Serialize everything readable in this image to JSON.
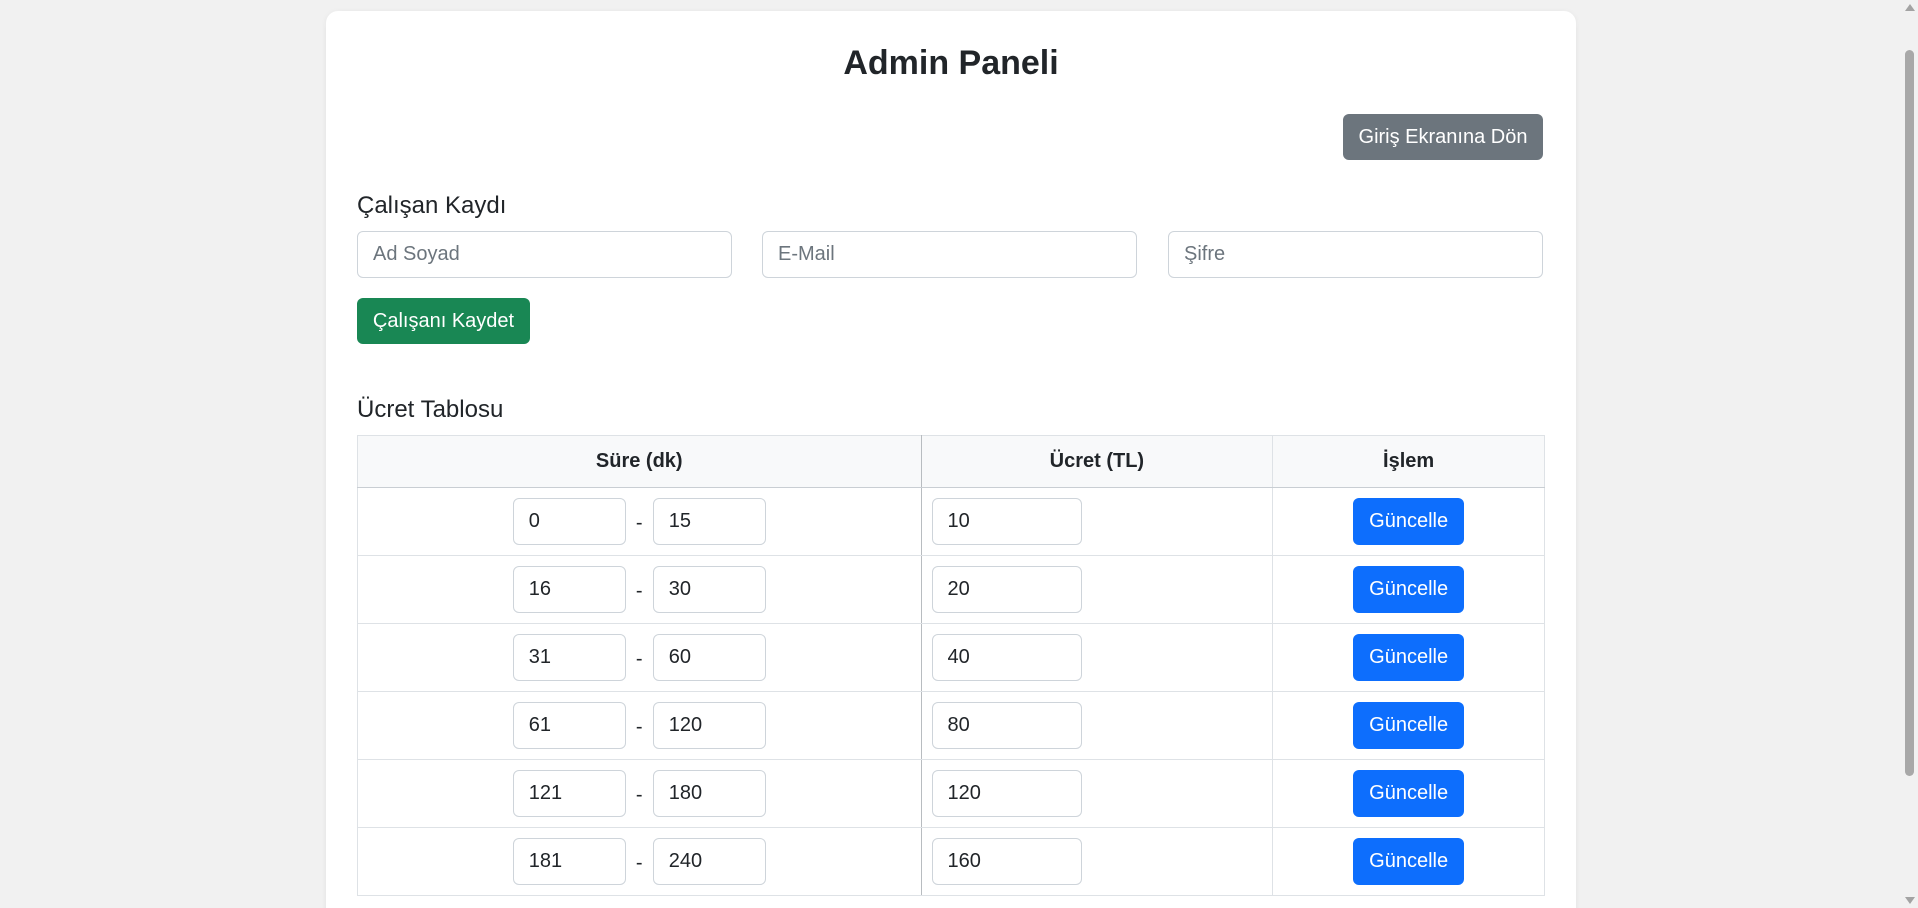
{
  "header": {
    "title": "Admin Paneli",
    "back_button_label": "Giriş Ekranına Dön"
  },
  "employee_form": {
    "heading": "Çalışan Kaydı",
    "name_placeholder": "Ad Soyad",
    "email_placeholder": "E-Mail",
    "password_placeholder": "Şifre",
    "save_button_label": "Çalışanı Kaydet"
  },
  "fee_table": {
    "heading": "Ücret Tablosu",
    "columns": [
      "Süre (dk)",
      "Ücret (TL)",
      "İşlem"
    ],
    "separator": "-",
    "rows": [
      {
        "min": "0",
        "max": "15",
        "fee": "10",
        "action_label": "Güncelle"
      },
      {
        "min": "16",
        "max": "30",
        "fee": "20",
        "action_label": "Güncelle"
      },
      {
        "min": "31",
        "max": "60",
        "fee": "40",
        "action_label": "Güncelle"
      },
      {
        "min": "61",
        "max": "120",
        "fee": "80",
        "action_label": "Güncelle"
      },
      {
        "min": "121",
        "max": "180",
        "fee": "120",
        "action_label": "Güncelle"
      },
      {
        "min": "181",
        "max": "240",
        "fee": "160",
        "action_label": "Güncelle"
      }
    ]
  },
  "colors": {
    "page_background": "#f1f1f1",
    "card_background": "#ffffff",
    "secondary_button": "#6c757d",
    "success_button": "#198754",
    "primary_button": "#0d6efd",
    "table_header_background": "#f8f9fa"
  }
}
